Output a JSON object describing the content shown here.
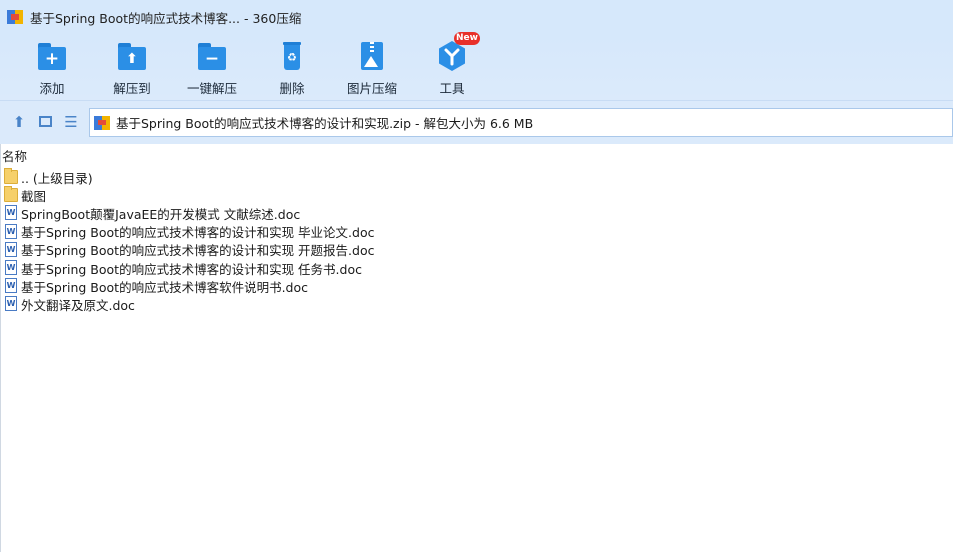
{
  "window": {
    "title": "基于Spring Boot的响应式技术博客... - 360压缩"
  },
  "toolbar": {
    "add": "添加",
    "extract_to": "解压到",
    "one_click_extract": "一键解压",
    "delete": "删除",
    "image_compress": "图片压缩",
    "tools": "工具",
    "tools_badge": "New"
  },
  "address": {
    "path": "基于Spring Boot的响应式技术博客的设计和实现.zip - 解包大小为 6.6 MB"
  },
  "list": {
    "column_name": "名称",
    "items": [
      {
        "name": ".. (上级目录)",
        "type": "folder"
      },
      {
        "name": "截图",
        "type": "folder"
      },
      {
        "name": "SpringBoot颠覆JavaEE的开发模式 文献综述.doc",
        "type": "doc"
      },
      {
        "name": "基于Spring Boot的响应式技术博客的设计和实现 毕业论文.doc",
        "type": "doc"
      },
      {
        "name": "基于Spring Boot的响应式技术博客的设计和实现 开题报告.doc",
        "type": "doc"
      },
      {
        "name": "基于Spring Boot的响应式技术博客的设计和实现 任务书.doc",
        "type": "doc"
      },
      {
        "name": "基于Spring Boot的响应式技术博客软件说明书.doc",
        "type": "doc"
      },
      {
        "name": "外文翻译及原文.doc",
        "type": "doc"
      }
    ]
  },
  "colors": {
    "chrome_bg": "#d6e8fb",
    "tool_blue": "#2b8fe6",
    "badge_red": "#e8302a",
    "folder_yellow": "#f6d06a"
  }
}
